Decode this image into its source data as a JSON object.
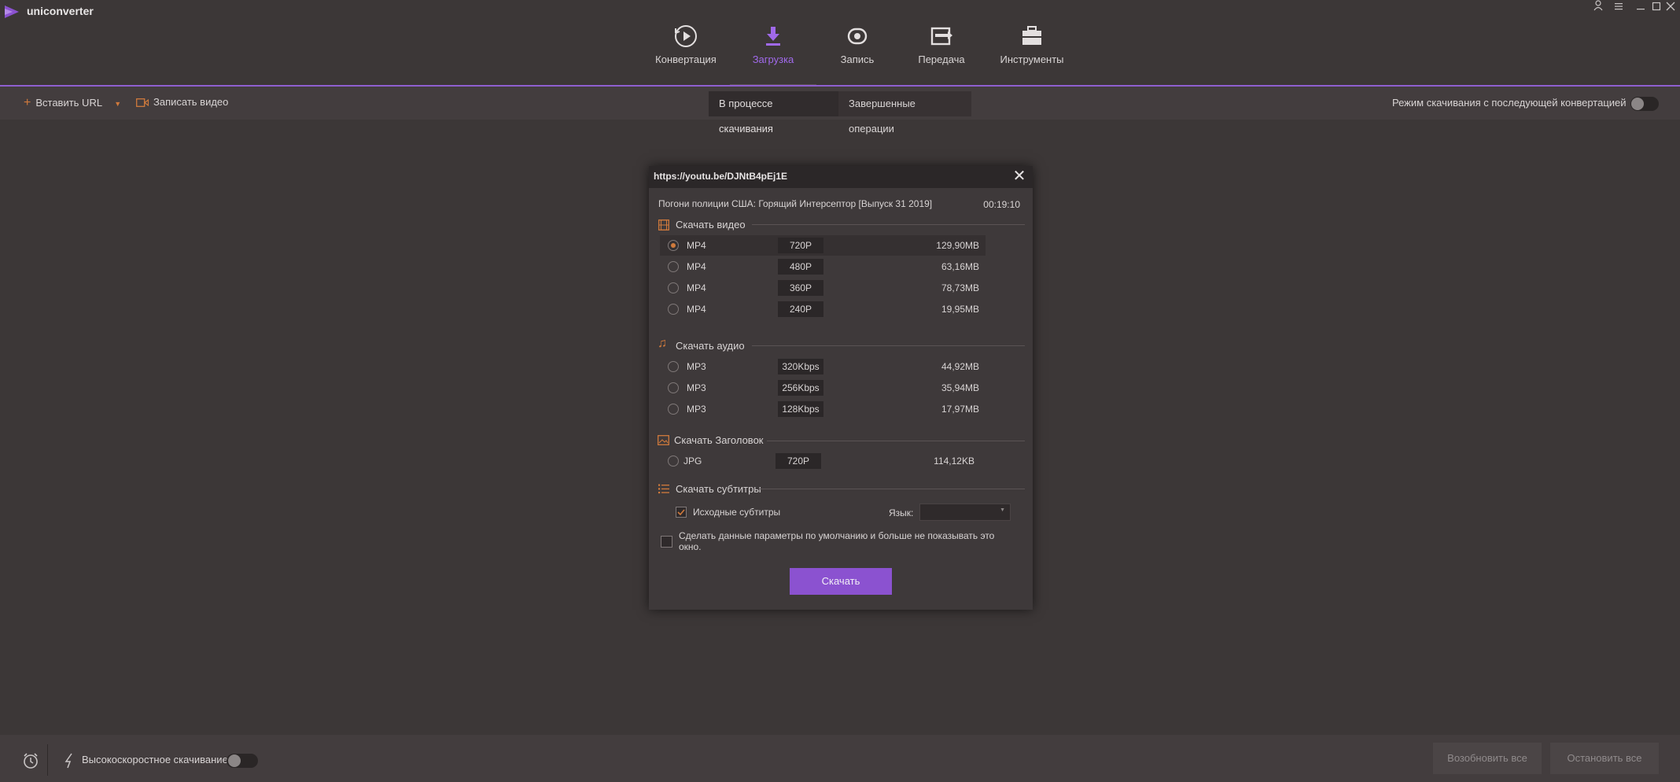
{
  "app": {
    "title": "uniconverter"
  },
  "window_controls": {
    "user": "user-icon",
    "menu": "menu-icon",
    "minimize": "minimize-icon",
    "maximize": "maximize-icon",
    "close": "close-icon"
  },
  "nav": {
    "items": [
      {
        "label": "Конвертация",
        "icon": "convert-play-icon"
      },
      {
        "label": "Загрузка",
        "icon": "download-icon",
        "active": true
      },
      {
        "label": "Запись",
        "icon": "record-icon"
      },
      {
        "label": "Передача",
        "icon": "transfer-icon"
      },
      {
        "label": "Инструменты",
        "icon": "toolbox-icon"
      }
    ]
  },
  "toolbar": {
    "paste_url": "Вставить URL",
    "record_video": "Записать видео",
    "tabs": [
      "В процессе скачивания",
      "Завершенные операции"
    ],
    "mode_label": "Режим скачивания с последующей конвертацией",
    "mode_enabled": false
  },
  "dialog": {
    "url": "https://youtu.be/DJNtB4pEj1E",
    "video_title": "Погони полиции США: Горящий Интерсептор [Выпуск 31 2019]",
    "duration": "00:19:10",
    "video_section": {
      "heading": "Скачать видео",
      "rows": [
        {
          "format": "MP4",
          "quality": "720P",
          "size": "129,90MB",
          "selected": true
        },
        {
          "format": "MP4",
          "quality": "480P",
          "size": "63,16MB",
          "selected": false
        },
        {
          "format": "MP4",
          "quality": "360P",
          "size": "78,73MB",
          "selected": false
        },
        {
          "format": "MP4",
          "quality": "240P",
          "size": "19,95MB",
          "selected": false
        }
      ]
    },
    "audio_section": {
      "heading": "Скачать аудио",
      "rows": [
        {
          "format": "MP3",
          "quality": "320Kbps",
          "size": "44,92MB"
        },
        {
          "format": "MP3",
          "quality": "256Kbps",
          "size": "35,94MB"
        },
        {
          "format": "MP3",
          "quality": "128Kbps",
          "size": "17,97MB"
        }
      ]
    },
    "thumbnail_section": {
      "heading": "Скачать Заголовок",
      "rows": [
        {
          "format": "JPG",
          "quality": "720P",
          "size": "114,12KB"
        }
      ]
    },
    "subtitles_section": {
      "heading": "Скачать субтитры",
      "original_label": "Исходные субтитры",
      "original_checked": true,
      "language_label": "Язык:",
      "language_value": ""
    },
    "default_checkbox_label": "Сделать данные параметры по умолчанию и больше не показывать это окно.",
    "default_checked": false,
    "download_button": "Скачать"
  },
  "bottombar": {
    "highspeed_label": "Высокоскоростное скачивание",
    "highspeed_enabled": false,
    "resume_all": "Возобновить все",
    "stop_all": "Остановить все"
  },
  "colors": {
    "accent": "#8b52d0",
    "nav_active": "#a069ea",
    "radio_dot": "#d07a3c",
    "icon_orange": "#d07a3c"
  }
}
